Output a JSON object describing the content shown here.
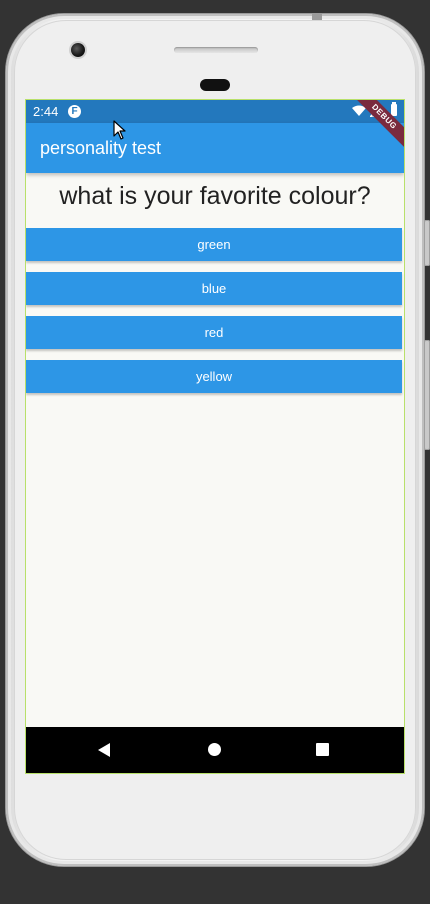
{
  "status_bar": {
    "time": "2:44",
    "app_icon": "F"
  },
  "debug_banner": {
    "label": "DEBUG"
  },
  "app_bar": {
    "title": "personality test"
  },
  "question": {
    "text": "what is your favorite colour?"
  },
  "answers": [
    {
      "label": "green"
    },
    {
      "label": "blue"
    },
    {
      "label": "red"
    },
    {
      "label": "yellow"
    }
  ],
  "colors": {
    "status_bar": "#2378bd",
    "app_bar": "#2d96e6",
    "button": "#2d96e6",
    "background": "#f9f9f5",
    "debug_banner": "#7a2a3e"
  },
  "icons": {
    "status": [
      "wifi-icon",
      "signal-icon",
      "battery-icon"
    ],
    "navigation": [
      "back-icon",
      "home-icon",
      "recents-icon"
    ]
  }
}
